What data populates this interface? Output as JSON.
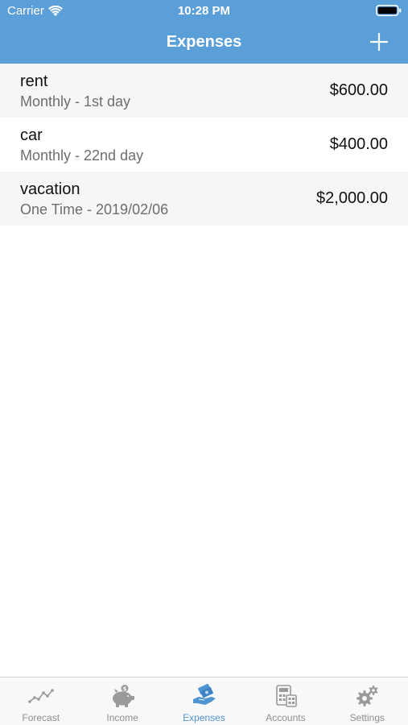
{
  "status_bar": {
    "carrier": "Carrier",
    "time": "10:28 PM"
  },
  "nav": {
    "title": "Expenses",
    "add_icon": "plus-icon"
  },
  "expenses": [
    {
      "name": "rent",
      "detail": "Monthly - 1st day",
      "amount": "$600.00"
    },
    {
      "name": "car",
      "detail": "Monthly - 22nd day",
      "amount": "$400.00"
    },
    {
      "name": "vacation",
      "detail": "One Time - 2019/02/06",
      "amount": "$2,000.00"
    }
  ],
  "tabs": [
    {
      "label": "Forecast",
      "icon": "chart-line-icon",
      "active": false
    },
    {
      "label": "Income",
      "icon": "piggy-bank-icon",
      "active": false
    },
    {
      "label": "Expenses",
      "icon": "money-hand-icon",
      "active": true
    },
    {
      "label": "Accounts",
      "icon": "calculator-icon",
      "active": false
    },
    {
      "label": "Settings",
      "icon": "gear-icon",
      "active": false
    }
  ],
  "colors": {
    "header": "#5b9fd9",
    "tab_active": "#4f95d4",
    "tab_inactive": "#8e8e8e"
  }
}
